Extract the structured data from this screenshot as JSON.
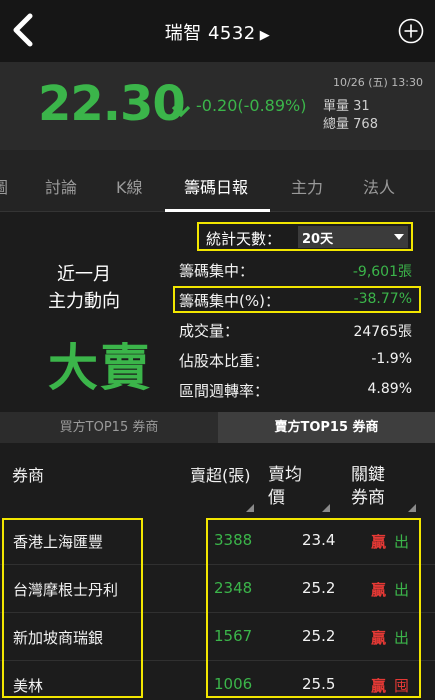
{
  "header": {
    "stock_name": "瑞智",
    "stock_code": "4532",
    "play_icon": "▶"
  },
  "quote": {
    "price": "22.30",
    "change": "-0.20(-0.89%)",
    "datetime": "10/26 (五) 13:30",
    "unit_volume_label": "單量",
    "unit_volume": "31",
    "total_volume_label": "總量",
    "total_volume": "768",
    "down_color": "#3bb54a"
  },
  "tabs": [
    {
      "label": "圖"
    },
    {
      "label": "討論"
    },
    {
      "label": "K線"
    },
    {
      "label": "籌碼日報"
    },
    {
      "label": "主力"
    },
    {
      "label": "法人"
    }
  ],
  "stats": {
    "days_label": "統計天數：",
    "days_value": "20天",
    "trend_line1": "近一月",
    "trend_line2": "主力動向",
    "trend_big": "大賣",
    "rows": [
      {
        "label": "籌碼集中：",
        "value": "-9,601張"
      },
      {
        "label": "籌碼集中(%)：",
        "value": "-38.77%"
      },
      {
        "label": "成交量：",
        "value": "24765張"
      },
      {
        "label": "佔股本比重：",
        "value": "-1.9%"
      },
      {
        "label": "區間週轉率：",
        "value": "4.89%"
      }
    ]
  },
  "segment": {
    "left": "買方TOP15 券商",
    "right": "賣方TOP15 券商"
  },
  "table": {
    "col_broker": "券商",
    "col_oversell": "賣超(張)",
    "col_avg_line1": "賣均",
    "col_avg_line2": "價",
    "col_key_line1": "關鍵",
    "col_key_line2": "券商",
    "rows": [
      {
        "broker": "香港上海匯豐",
        "oversell": "3388",
        "avg": "23.4",
        "k1": "贏",
        "k2": "出"
      },
      {
        "broker": "台灣摩根士丹利",
        "oversell": "2348",
        "avg": "25.2",
        "k1": "贏",
        "k2": "出"
      },
      {
        "broker": "新加坡商瑞銀",
        "oversell": "1567",
        "avg": "25.2",
        "k1": "贏",
        "k2": "出"
      },
      {
        "broker": "美林",
        "oversell": "1006",
        "avg": "25.5",
        "k1": "贏",
        "k2": "囤"
      }
    ]
  },
  "icons": {
    "back": "chevron-left-icon",
    "add": "plus-circle-icon",
    "down": "arrow-down-icon",
    "dropdown": "caret-down-icon"
  }
}
